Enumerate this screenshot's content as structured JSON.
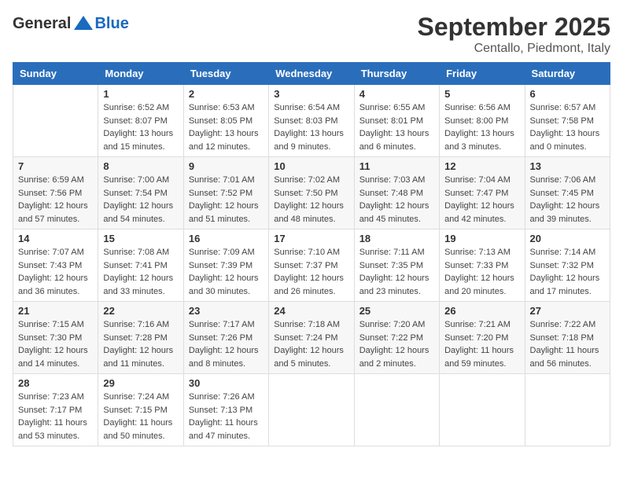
{
  "header": {
    "logo_general": "General",
    "logo_blue": "Blue",
    "month_title": "September 2025",
    "location": "Centallo, Piedmont, Italy"
  },
  "columns": [
    "Sunday",
    "Monday",
    "Tuesday",
    "Wednesday",
    "Thursday",
    "Friday",
    "Saturday"
  ],
  "weeks": [
    [
      {
        "day": "",
        "info": ""
      },
      {
        "day": "1",
        "info": "Sunrise: 6:52 AM\nSunset: 8:07 PM\nDaylight: 13 hours\nand 15 minutes."
      },
      {
        "day": "2",
        "info": "Sunrise: 6:53 AM\nSunset: 8:05 PM\nDaylight: 13 hours\nand 12 minutes."
      },
      {
        "day": "3",
        "info": "Sunrise: 6:54 AM\nSunset: 8:03 PM\nDaylight: 13 hours\nand 9 minutes."
      },
      {
        "day": "4",
        "info": "Sunrise: 6:55 AM\nSunset: 8:01 PM\nDaylight: 13 hours\nand 6 minutes."
      },
      {
        "day": "5",
        "info": "Sunrise: 6:56 AM\nSunset: 8:00 PM\nDaylight: 13 hours\nand 3 minutes."
      },
      {
        "day": "6",
        "info": "Sunrise: 6:57 AM\nSunset: 7:58 PM\nDaylight: 13 hours\nand 0 minutes."
      }
    ],
    [
      {
        "day": "7",
        "info": "Sunrise: 6:59 AM\nSunset: 7:56 PM\nDaylight: 12 hours\nand 57 minutes."
      },
      {
        "day": "8",
        "info": "Sunrise: 7:00 AM\nSunset: 7:54 PM\nDaylight: 12 hours\nand 54 minutes."
      },
      {
        "day": "9",
        "info": "Sunrise: 7:01 AM\nSunset: 7:52 PM\nDaylight: 12 hours\nand 51 minutes."
      },
      {
        "day": "10",
        "info": "Sunrise: 7:02 AM\nSunset: 7:50 PM\nDaylight: 12 hours\nand 48 minutes."
      },
      {
        "day": "11",
        "info": "Sunrise: 7:03 AM\nSunset: 7:48 PM\nDaylight: 12 hours\nand 45 minutes."
      },
      {
        "day": "12",
        "info": "Sunrise: 7:04 AM\nSunset: 7:47 PM\nDaylight: 12 hours\nand 42 minutes."
      },
      {
        "day": "13",
        "info": "Sunrise: 7:06 AM\nSunset: 7:45 PM\nDaylight: 12 hours\nand 39 minutes."
      }
    ],
    [
      {
        "day": "14",
        "info": "Sunrise: 7:07 AM\nSunset: 7:43 PM\nDaylight: 12 hours\nand 36 minutes."
      },
      {
        "day": "15",
        "info": "Sunrise: 7:08 AM\nSunset: 7:41 PM\nDaylight: 12 hours\nand 33 minutes."
      },
      {
        "day": "16",
        "info": "Sunrise: 7:09 AM\nSunset: 7:39 PM\nDaylight: 12 hours\nand 30 minutes."
      },
      {
        "day": "17",
        "info": "Sunrise: 7:10 AM\nSunset: 7:37 PM\nDaylight: 12 hours\nand 26 minutes."
      },
      {
        "day": "18",
        "info": "Sunrise: 7:11 AM\nSunset: 7:35 PM\nDaylight: 12 hours\nand 23 minutes."
      },
      {
        "day": "19",
        "info": "Sunrise: 7:13 AM\nSunset: 7:33 PM\nDaylight: 12 hours\nand 20 minutes."
      },
      {
        "day": "20",
        "info": "Sunrise: 7:14 AM\nSunset: 7:32 PM\nDaylight: 12 hours\nand 17 minutes."
      }
    ],
    [
      {
        "day": "21",
        "info": "Sunrise: 7:15 AM\nSunset: 7:30 PM\nDaylight: 12 hours\nand 14 minutes."
      },
      {
        "day": "22",
        "info": "Sunrise: 7:16 AM\nSunset: 7:28 PM\nDaylight: 12 hours\nand 11 minutes."
      },
      {
        "day": "23",
        "info": "Sunrise: 7:17 AM\nSunset: 7:26 PM\nDaylight: 12 hours\nand 8 minutes."
      },
      {
        "day": "24",
        "info": "Sunrise: 7:18 AM\nSunset: 7:24 PM\nDaylight: 12 hours\nand 5 minutes."
      },
      {
        "day": "25",
        "info": "Sunrise: 7:20 AM\nSunset: 7:22 PM\nDaylight: 12 hours\nand 2 minutes."
      },
      {
        "day": "26",
        "info": "Sunrise: 7:21 AM\nSunset: 7:20 PM\nDaylight: 11 hours\nand 59 minutes."
      },
      {
        "day": "27",
        "info": "Sunrise: 7:22 AM\nSunset: 7:18 PM\nDaylight: 11 hours\nand 56 minutes."
      }
    ],
    [
      {
        "day": "28",
        "info": "Sunrise: 7:23 AM\nSunset: 7:17 PM\nDaylight: 11 hours\nand 53 minutes."
      },
      {
        "day": "29",
        "info": "Sunrise: 7:24 AM\nSunset: 7:15 PM\nDaylight: 11 hours\nand 50 minutes."
      },
      {
        "day": "30",
        "info": "Sunrise: 7:26 AM\nSunset: 7:13 PM\nDaylight: 11 hours\nand 47 minutes."
      },
      {
        "day": "",
        "info": ""
      },
      {
        "day": "",
        "info": ""
      },
      {
        "day": "",
        "info": ""
      },
      {
        "day": "",
        "info": ""
      }
    ]
  ]
}
